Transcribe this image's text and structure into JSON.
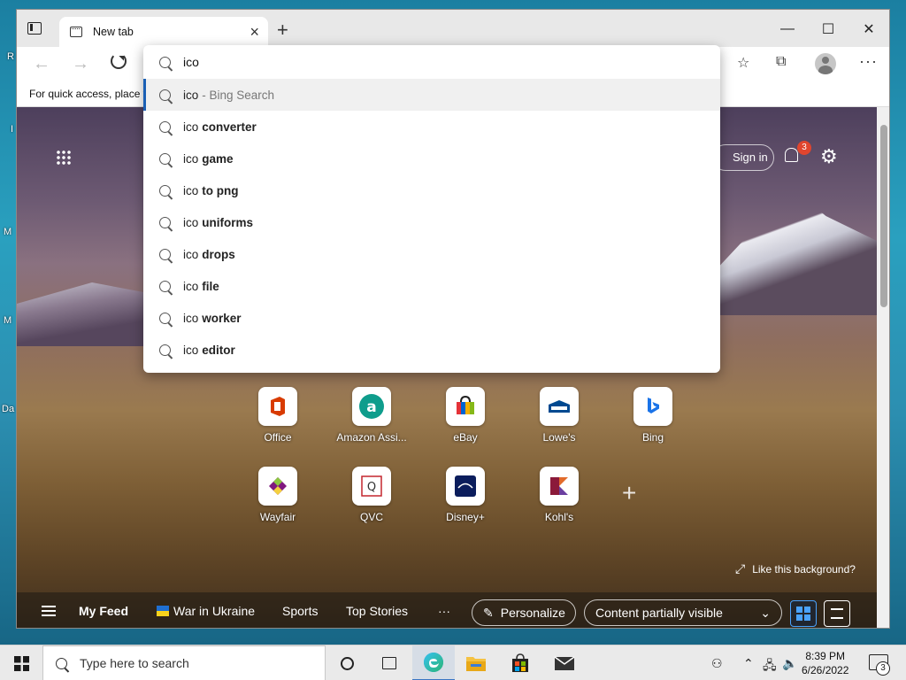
{
  "desktop": {
    "labels": [
      "R",
      "I",
      "M",
      "M",
      "Da"
    ]
  },
  "browser": {
    "tab": {
      "title": "New tab"
    },
    "window_controls": {
      "minimize": "—",
      "maximize": "☐",
      "close": "✕"
    },
    "favorites_bar": {
      "text": "For quick access, place y"
    },
    "omnibox": {
      "query": "ico",
      "suggestions": [
        {
          "query": "ico",
          "suffix": "",
          "engine": "- Bing Search"
        },
        {
          "query": "ico",
          "suffix": "converter",
          "engine": ""
        },
        {
          "query": "ico",
          "suffix": "game",
          "engine": ""
        },
        {
          "query": "ico",
          "suffix": "to png",
          "engine": ""
        },
        {
          "query": "ico",
          "suffix": "uniforms",
          "engine": ""
        },
        {
          "query": "ico",
          "suffix": "drops",
          "engine": ""
        },
        {
          "query": "ico",
          "suffix": "file",
          "engine": ""
        },
        {
          "query": "ico",
          "suffix": "worker",
          "engine": ""
        },
        {
          "query": "ico",
          "suffix": "editor",
          "engine": ""
        }
      ]
    }
  },
  "newtab": {
    "sign_in": "Sign in",
    "notification_count": "3",
    "tiles": [
      {
        "label": "Office",
        "color": "#d83b01"
      },
      {
        "label": "Amazon Assi...",
        "color": "#0f9d8c"
      },
      {
        "label": "eBay",
        "color": "#e53238"
      },
      {
        "label": "Lowe's",
        "color": "#004990"
      },
      {
        "label": "Bing",
        "color": "#008373"
      },
      {
        "label": "Wayfair",
        "color": "#7f187f"
      },
      {
        "label": "QVC",
        "color": "#c4262e"
      },
      {
        "label": "Disney+",
        "color": "#113ccf"
      },
      {
        "label": "Kohl's",
        "color": "#8b1a3a"
      }
    ],
    "add_tile": "+",
    "like_background": "Like this background?",
    "feed": {
      "my_feed": "My Feed",
      "links": [
        "War in Ukraine",
        "Sports",
        "Top Stories"
      ],
      "more": "···",
      "personalize": "Personalize",
      "content_visibility": "Content partially visible"
    }
  },
  "taskbar": {
    "search_placeholder": "Type here to search",
    "time": "8:39 PM",
    "date": "6/26/2022",
    "notification_count": "3"
  }
}
